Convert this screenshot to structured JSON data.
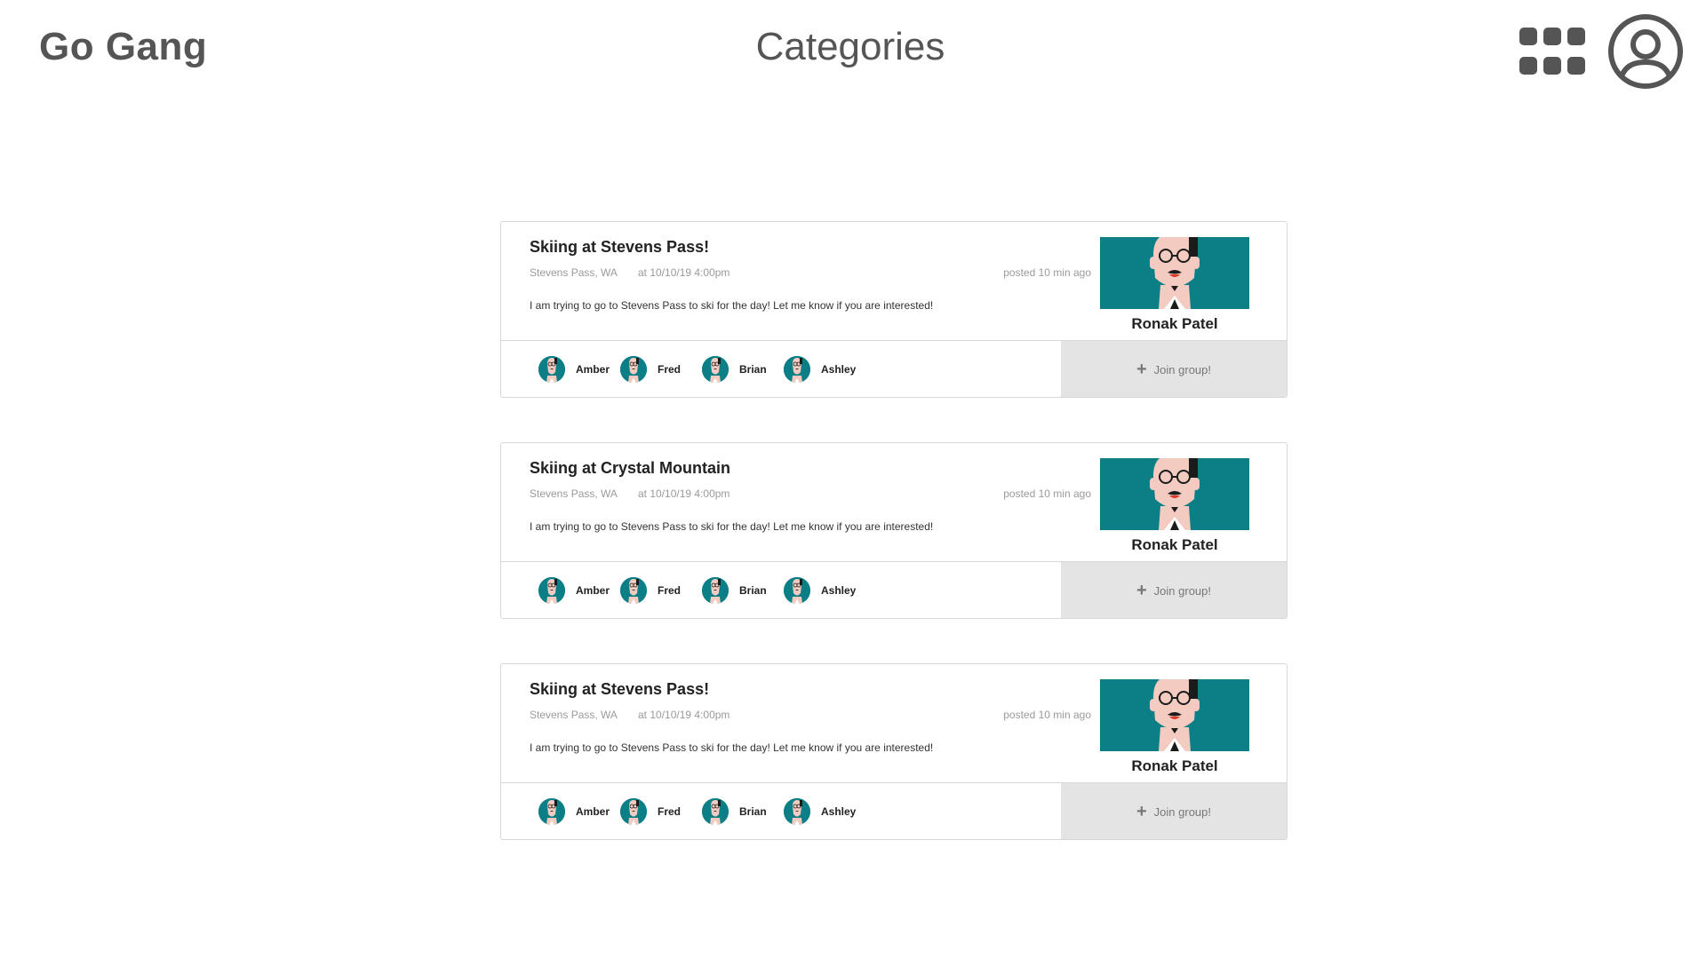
{
  "header": {
    "brand": "Go Gang",
    "title": "Categories"
  },
  "posts": [
    {
      "title": "Skiing at Stevens Pass!",
      "location": "Stevens Pass, WA",
      "time": "at 10/10/19  4:00pm",
      "posted": "posted 10 min ago",
      "description": "I am trying to go to Stevens Pass to ski for the day! Let me know if you are interested!",
      "host_name": "Ronak Patel",
      "members": [
        "Amber",
        "Fred",
        "Brian",
        "Ashley"
      ],
      "join_label": "Join group!"
    },
    {
      "title": "Skiing at Crystal Mountain",
      "location": "Stevens Pass, WA",
      "time": "at 10/10/19  4:00pm",
      "posted": "posted 10 min ago",
      "description": "I am trying to go to Stevens Pass to ski for the day! Let me know if you are interested!",
      "host_name": "Ronak Patel",
      "members": [
        "Amber",
        "Fred",
        "Brian",
        "Ashley"
      ],
      "join_label": "Join group!"
    },
    {
      "title": "Skiing at Stevens Pass!",
      "location": "Stevens Pass, WA",
      "time": "at 10/10/19  4:00pm",
      "posted": "posted 10 min ago",
      "description": "I am trying to go to Stevens Pass to ski for the day! Let me know if you are interested!",
      "host_name": "Ronak Patel",
      "members": [
        "Amber",
        "Fred",
        "Brian",
        "Ashley"
      ],
      "join_label": "Join group!"
    }
  ],
  "icons": {
    "apps": "grid-icon",
    "profile": "user-circle-icon",
    "join": "plus-icon"
  },
  "colors": {
    "accent_teal": "#0b7f85",
    "join_bg": "#e4e4e5",
    "header_text": "#555555"
  }
}
